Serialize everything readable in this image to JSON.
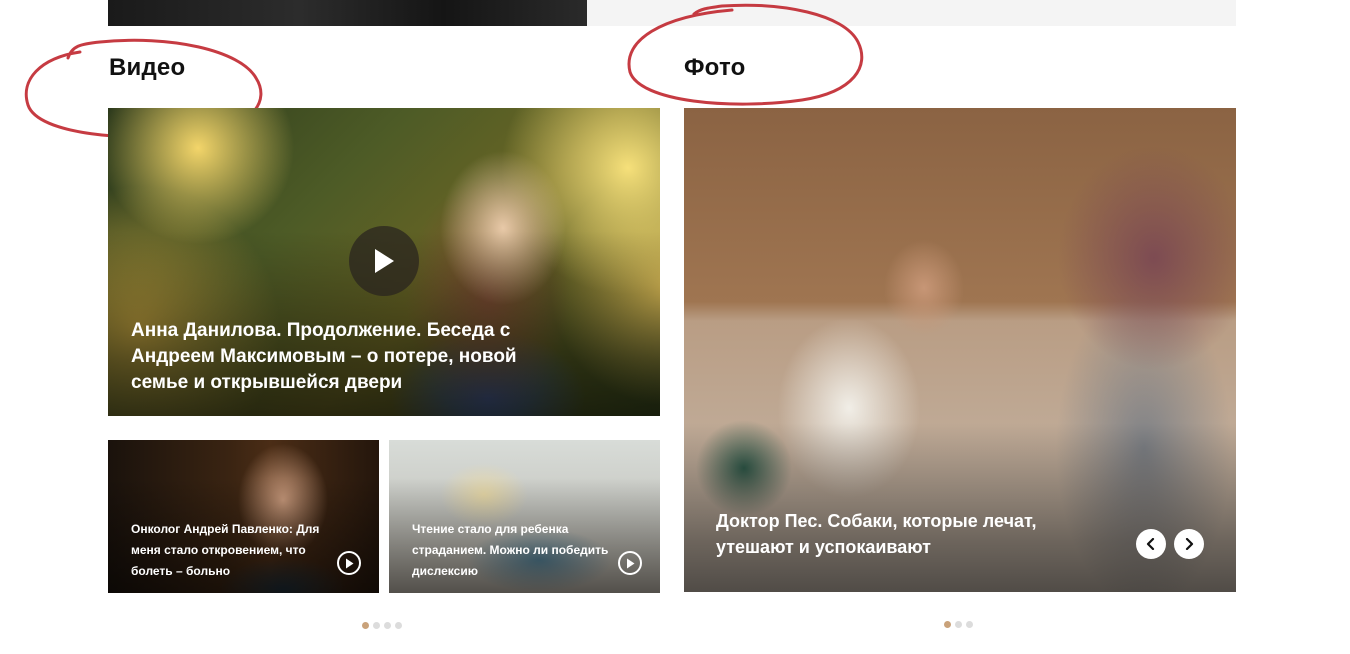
{
  "sections": {
    "video": {
      "title": "Видео",
      "main": {
        "caption": "Анна Данилова. Продолжение. Беседа с Андреем Максимовым – о потере, новой семье и открывшейся двери"
      },
      "small": [
        {
          "caption": "Онколог Андрей Павленко: Для меня стало откровением, что болеть – больно"
        },
        {
          "caption": "Чтение стало для ребенка страданием. Можно ли победить дислексию"
        }
      ],
      "pagination": {
        "total": 4,
        "active": 1
      }
    },
    "photo": {
      "title": "Фото",
      "main": {
        "caption": "Доктор Пес. Собаки, которые лечат, утешают и успокаивают"
      },
      "pagination": {
        "total": 3,
        "active": 1
      }
    }
  },
  "icons": {
    "play": "play-icon",
    "prev": "chevron-left-icon",
    "next": "chevron-right-icon"
  },
  "colors": {
    "accent_dot": "#c9a27a",
    "scribble": "#c0262e"
  }
}
